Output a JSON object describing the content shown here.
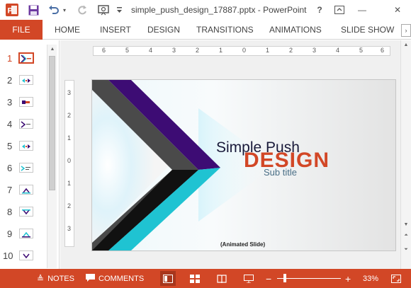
{
  "window": {
    "title": "simple_push_design_17887.pptx - PowerPoint",
    "help_label": "?",
    "minimize_label": "—",
    "close_label": "✕"
  },
  "ribbon": {
    "file_label": "FILE",
    "tabs": [
      "HOME",
      "INSERT",
      "DESIGN",
      "TRANSITIONS",
      "ANIMATIONS",
      "SLIDE SHOW"
    ]
  },
  "thumbnails": {
    "items": [
      {
        "number": "1"
      },
      {
        "number": "2"
      },
      {
        "number": "3"
      },
      {
        "number": "4"
      },
      {
        "number": "5"
      },
      {
        "number": "6"
      },
      {
        "number": "7"
      },
      {
        "number": "8"
      },
      {
        "number": "9"
      },
      {
        "number": "10"
      }
    ],
    "selected": "1"
  },
  "ruler": {
    "horizontal": [
      "6",
      "5",
      "4",
      "3",
      "2",
      "1",
      "0",
      "1",
      "2",
      "3",
      "4",
      "5",
      "6"
    ],
    "vertical": [
      "3",
      "2",
      "1",
      "0",
      "1",
      "2",
      "3"
    ]
  },
  "slide": {
    "title_line1": "Simple Push",
    "title_line2": "DESIGN",
    "subtitle": "Sub title",
    "caption": "(Animated Slide)"
  },
  "statusbar": {
    "notes_label": "NOTES",
    "comments_label": "COMMENTS",
    "zoom_out_label": "−",
    "zoom_in_label": "+",
    "zoom_level": "33%"
  },
  "colors": {
    "accent": "#d24726",
    "purple": "#3d0c74",
    "teal": "#1fc3d2"
  }
}
